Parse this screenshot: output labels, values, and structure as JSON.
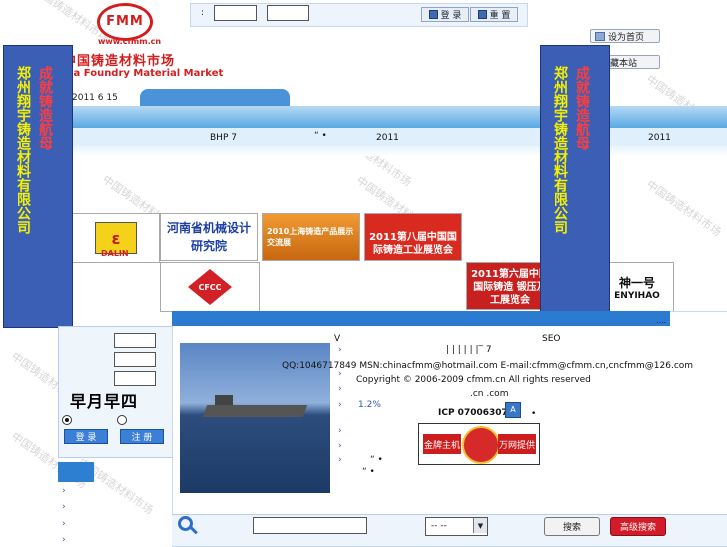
{
  "watermark_text": "中国铸造材料市场",
  "logo": {
    "mark": "FMM",
    "url": "www.cfmm.cn",
    "cn_name": "中国铸造材料市场",
    "en_name": "ina Foundry Material Market"
  },
  "login_bar": {
    "colon": ":",
    "login_label": "登 录",
    "reset_label": "重 置"
  },
  "side_links": {
    "set_home": "设为首页",
    "bookmark": "收藏本站"
  },
  "vertical_banner": {
    "col1": "郑州翔宇铸造材料有限公司",
    "col2": "成就铸造航母"
  },
  "date_text": "2011 6 15",
  "ticker": {
    "item1": "BHP  7",
    "item2": "“ •",
    "item3": "2011",
    "item4": "2011"
  },
  "ads": {
    "dalin": "DALIN",
    "design_institute": "河南省机械设计研究院",
    "expo_2010": "2010上海铸造产品展示交流展",
    "expo_2011": "2011第八届中国国际铸造工业展览会",
    "expo_6th": "2011第六届中国国际铸造 锻压及工展览会",
    "shenyihao": "神一号",
    "shenyihao_en": "ENYIHAO",
    "cfcc": "CFCC"
  },
  "login_panel": {
    "captcha": "早月早四",
    "login_label": "登 录",
    "register_label": "注 册"
  },
  "main": {
    "dots": "....",
    "v": "V",
    "seo": "SEO",
    "bars": "| | | | | |‾ 7",
    "contact": "QQ:1046717849  MSN:chinacfmm@hotmail.com  E-mail:cfmm@cfmm.cn,cncfmm@126.com",
    "copyright": "Copyright © 2006-2009 cfmm.cn All rights reserved",
    "domains": ".cn     .com",
    "percent": "1.2%",
    "icp": "ICP  07006307",
    "icp_after": "•",
    "list_marks": [
      "›",
      "›",
      "›",
      "›",
      "›",
      "›",
      "›"
    ],
    "row_note1": "“  •",
    "row_note2": "“ •",
    "badge_left": "金牌主机",
    "badge_right": "万网提供"
  },
  "left_list_marks": [
    "›",
    "›",
    "›",
    "›"
  ],
  "search": {
    "select_value": "-- --",
    "search_label": "搜索",
    "advanced_label": "高级搜索"
  }
}
